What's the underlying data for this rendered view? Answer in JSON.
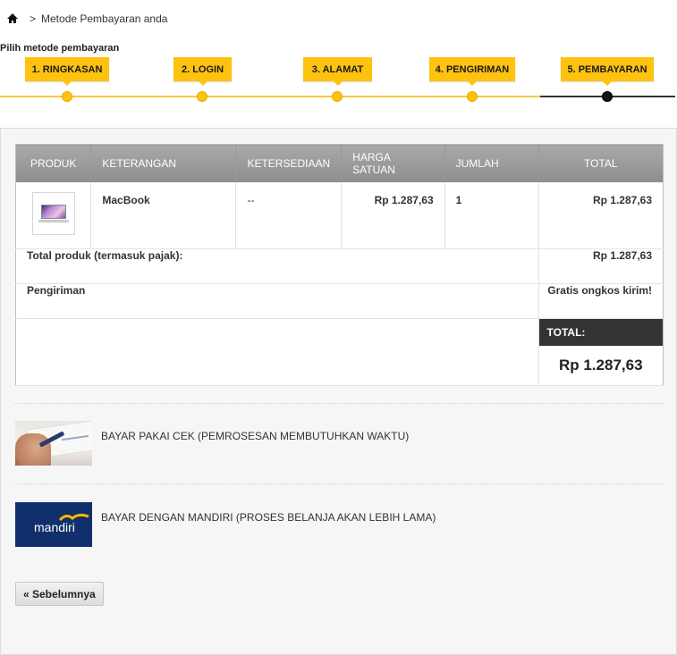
{
  "breadcrumb": {
    "separator": ">",
    "current": "Metode Pembayaran anda"
  },
  "steps_title": "Pilih metode pembayaran",
  "steps": [
    {
      "label": "1. RINGKASAN",
      "active": false
    },
    {
      "label": "2. LOGIN",
      "active": false
    },
    {
      "label": "3. ALAMAT",
      "active": false
    },
    {
      "label": "4. PENGIRIMAN",
      "active": false
    },
    {
      "label": "5. PEMBAYARAN",
      "active": true
    }
  ],
  "cart": {
    "headers": {
      "product": "PRODUK",
      "description": "KETERANGAN",
      "availability": "KETERSEDIAAN",
      "unit_price": "HARGA SATUAN",
      "quantity": "JUMLAH",
      "total": "TOTAL"
    },
    "items": [
      {
        "name": "MacBook",
        "availability": "--",
        "unit_price": "Rp 1.287,63",
        "quantity": "1",
        "total": "Rp 1.287,63"
      }
    ],
    "total_products_label": "Total produk (termasuk pajak):",
    "total_products_value": "Rp 1.287,63",
    "shipping_label": "Pengiriman",
    "shipping_value": "Gratis ongkos kirim!",
    "grand_total_label": "TOTAL:",
    "grand_total_value": "Rp 1.287,63"
  },
  "payment_methods": [
    {
      "label": "BAYAR PAKAI CEK (PEMROSESAN MEMBUTUHKAN WAKTU)",
      "logo": "cheque-image"
    },
    {
      "label": "BAYAR DENGAN MANDIRI (PROSES BELANJA AKAN LEBIH LAMA)",
      "logo": "mandiri-logo",
      "logo_text": "mandiri"
    }
  ],
  "back_button": "« Sebelumnya",
  "colors": {
    "accent": "#fec20f",
    "header_gray": "#999999",
    "dark": "#333333"
  }
}
